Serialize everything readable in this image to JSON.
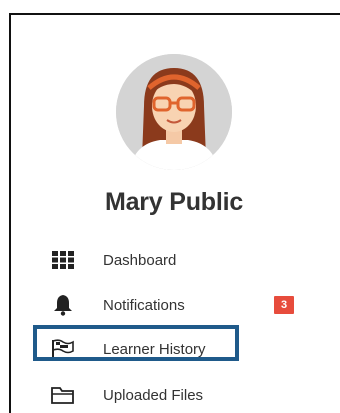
{
  "profile": {
    "name": "Mary Public",
    "avatar_icon": "user-avatar-woman-glasses"
  },
  "nav": {
    "items": [
      {
        "label": "Dashboard",
        "icon": "grid-icon"
      },
      {
        "label": "Notifications",
        "icon": "bell-icon",
        "badge": "3"
      },
      {
        "label": "Learner History",
        "icon": "flag-icon",
        "highlighted": true
      },
      {
        "label": "Uploaded Files",
        "icon": "folder-icon"
      }
    ]
  },
  "colors": {
    "badge": "#e74c3c",
    "highlight": "#1f5a8a",
    "text": "#333333",
    "avatar_bg": "#d9d9d9",
    "hair": "#8b3a1c"
  }
}
